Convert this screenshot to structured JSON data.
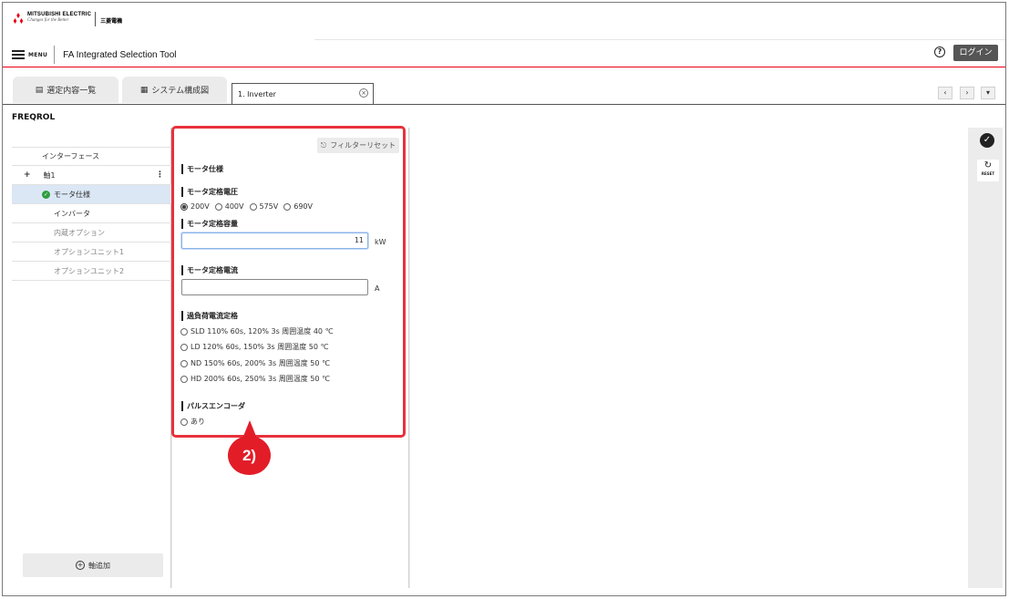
{
  "header": {
    "brand": "MITSUBISHI ELECTRIC",
    "tagline": "Changes for the Better",
    "brand_jp": "三菱電機",
    "menu_label": "MENU",
    "app_title": "FA Integrated Selection Tool",
    "help_glyph": "?",
    "login_label": "ログイン"
  },
  "tabs": [
    {
      "label": "選定内容一覧",
      "icon": "list-icon"
    },
    {
      "label": "システム構成図",
      "icon": "hierarchy-icon"
    },
    {
      "label": "1. Inverter",
      "icon": "close-icon"
    }
  ],
  "tab_nav": {
    "prev": "‹",
    "next": "›",
    "more": "▾"
  },
  "section_title": "FREQROL",
  "tree": {
    "interface": "インターフェース",
    "axis": "軸1",
    "items": [
      "モータ仕様",
      "インバータ",
      "内蔵オプション",
      "オプションユニット1",
      "オプションユニット2"
    ],
    "add_axis": "軸追加"
  },
  "form": {
    "filter_reset": "フィルターリセット",
    "motor_spec": "モータ仕様",
    "rated_voltage": {
      "title": "モータ定格電圧",
      "options": [
        "200V",
        "400V",
        "575V",
        "690V"
      ],
      "selected": "200V"
    },
    "rated_capacity": {
      "title": "モータ定格容量",
      "value": "11",
      "unit": "kW"
    },
    "rated_current": {
      "title": "モータ定格電流",
      "value": "",
      "unit": "A"
    },
    "overload": {
      "title": "過負荷電流定格",
      "options": [
        "SLD 110% 60s, 120% 3s 周囲温度 40 ℃",
        "LD 120% 60s, 150% 3s 周囲温度 50 ℃",
        "ND 150% 60s, 200% 3s 周囲温度 50 ℃",
        "HD 200% 60s, 250% 3s 周囲温度 50 ℃"
      ]
    },
    "encoder": {
      "title": "パルスエンコーダ",
      "option": "あり"
    }
  },
  "rail": {
    "reset_label": "RESET"
  },
  "annotation": {
    "badge": "2)"
  },
  "colors": {
    "accent_red": "#e60012",
    "callout_red": "#e8313b",
    "selected_row": "#dbe7f5",
    "check_green": "#2e9e3f"
  }
}
